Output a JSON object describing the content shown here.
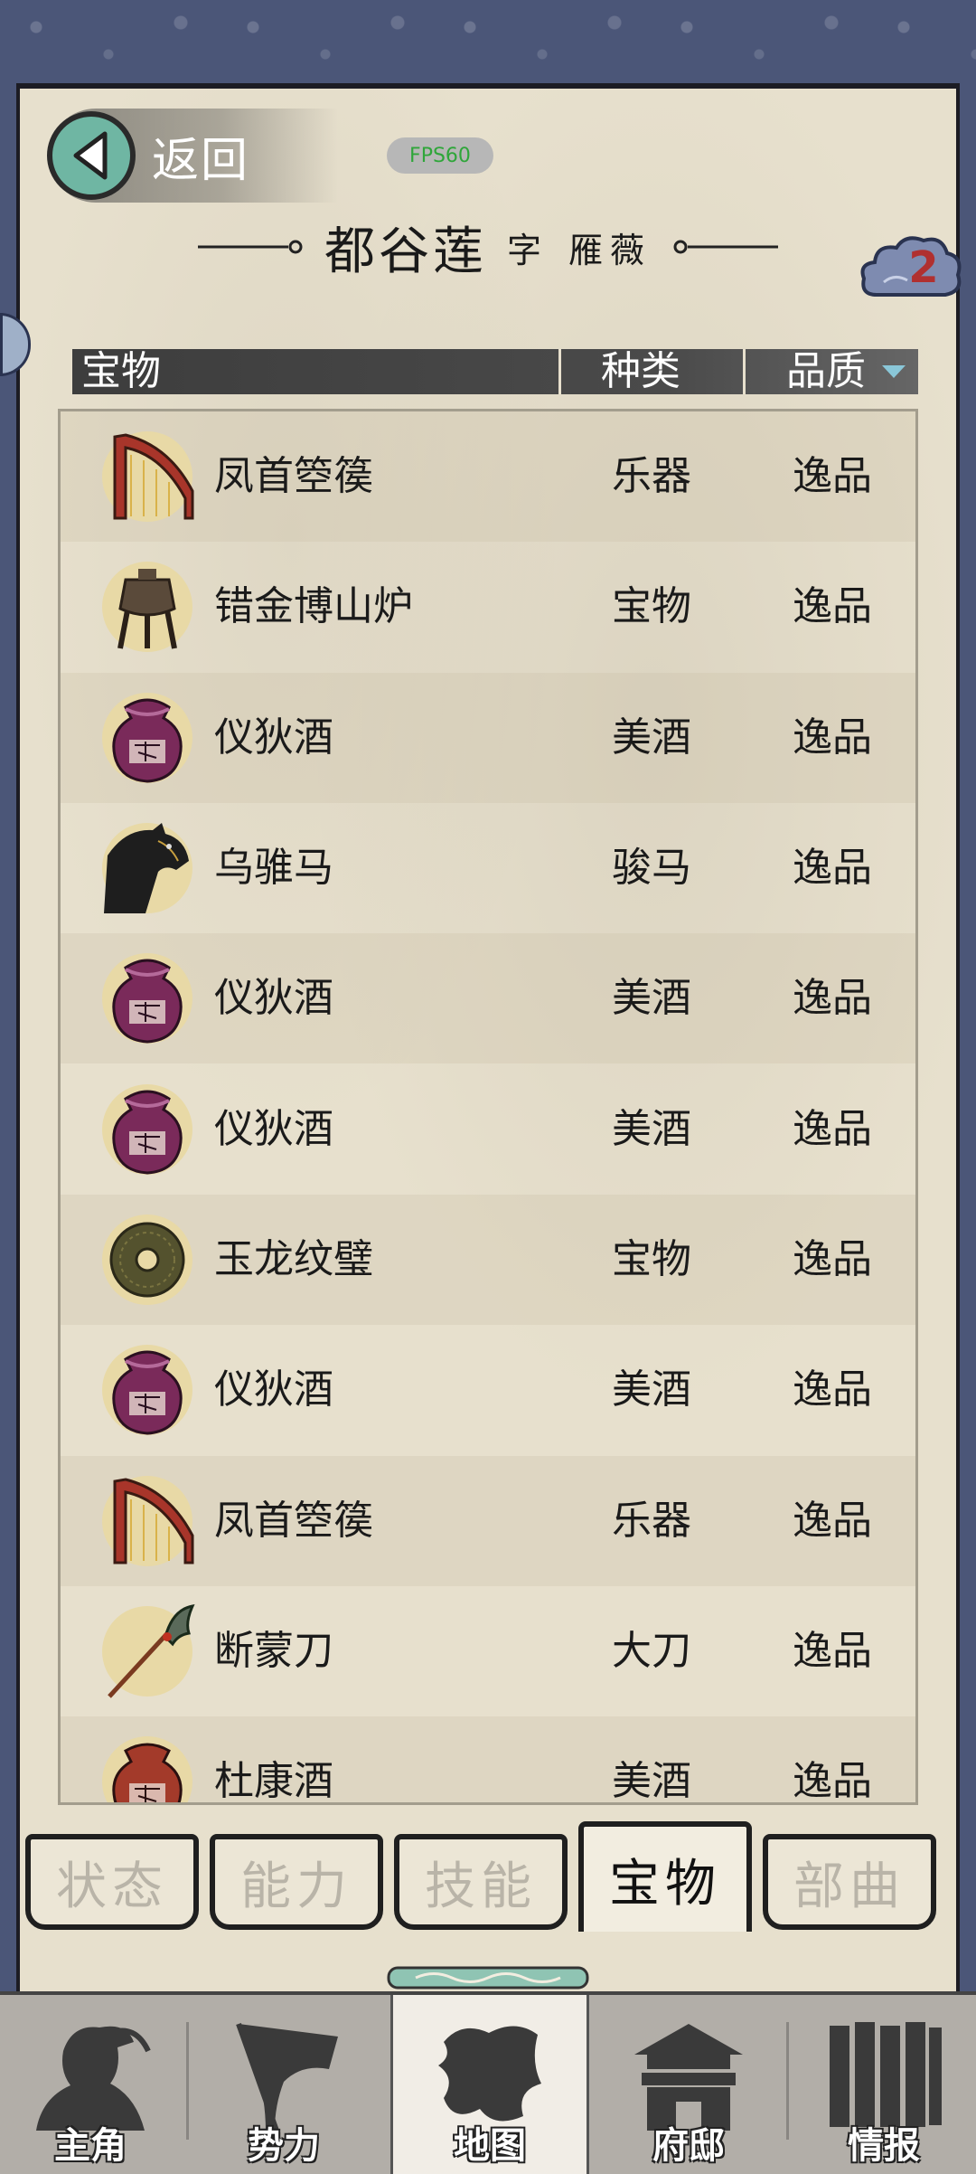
{
  "header": {
    "back_label": "返回",
    "fps_label": "FPS60",
    "character_name": "都谷莲",
    "courtesy_prefix": "字",
    "courtesy_name": "雁薇",
    "notification_count": "2"
  },
  "table": {
    "columns": {
      "treasure": "宝物",
      "kind": "种类",
      "quality": "品质"
    },
    "rows": [
      {
        "name": "凤首箜篌",
        "kind": "乐器",
        "quality": "逸品",
        "icon": "harp-icon"
      },
      {
        "name": "错金博山炉",
        "kind": "宝物",
        "quality": "逸品",
        "icon": "censer-icon"
      },
      {
        "name": "仪狄酒",
        "kind": "美酒",
        "quality": "逸品",
        "icon": "wine-jar-icon"
      },
      {
        "name": "乌骓马",
        "kind": "骏马",
        "quality": "逸品",
        "icon": "horse-icon"
      },
      {
        "name": "仪狄酒",
        "kind": "美酒",
        "quality": "逸品",
        "icon": "wine-jar-icon"
      },
      {
        "name": "仪狄酒",
        "kind": "美酒",
        "quality": "逸品",
        "icon": "wine-jar-icon"
      },
      {
        "name": "玉龙纹璧",
        "kind": "宝物",
        "quality": "逸品",
        "icon": "jade-disc-icon"
      },
      {
        "name": "仪狄酒",
        "kind": "美酒",
        "quality": "逸品",
        "icon": "wine-jar-icon"
      },
      {
        "name": "凤首箜篌",
        "kind": "乐器",
        "quality": "逸品",
        "icon": "harp-icon"
      },
      {
        "name": "断蒙刀",
        "kind": "大刀",
        "quality": "逸品",
        "icon": "glaive-icon"
      },
      {
        "name": "杜康酒",
        "kind": "美酒",
        "quality": "逸品",
        "icon": "red-wine-jar-icon"
      }
    ]
  },
  "tabs": [
    "状态",
    "能力",
    "技能",
    "宝物",
    "部曲"
  ],
  "active_tab": "宝物",
  "nav": [
    "主角",
    "势力",
    "地图",
    "府邸",
    "情报"
  ],
  "active_nav": "地图",
  "colors": {
    "frame": "#4b5678",
    "paper": "#e7e0cd",
    "back_circle": "#6fb6a3",
    "fps_text": "#2fa63a",
    "notification": "#b03030"
  }
}
